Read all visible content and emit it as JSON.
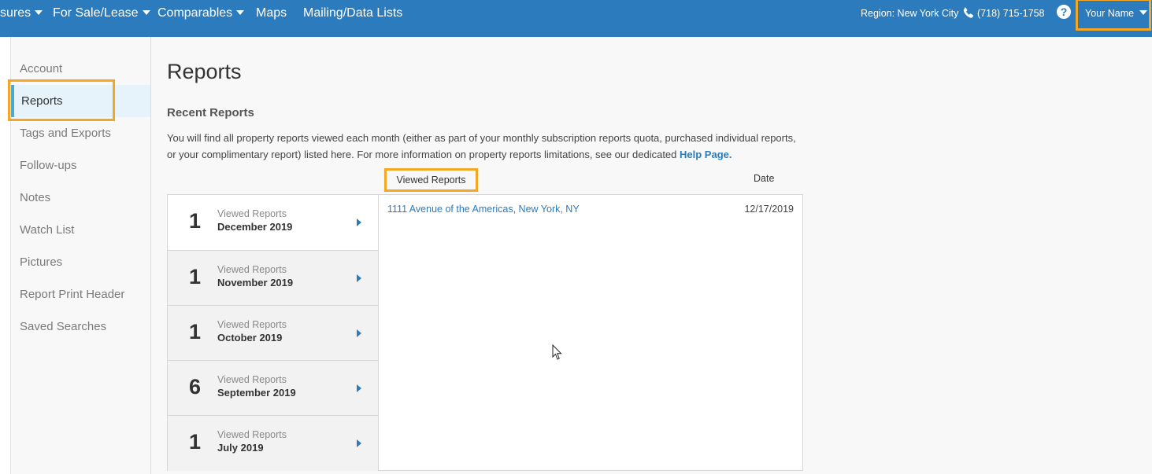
{
  "header": {
    "nav": [
      {
        "label": "sures",
        "caret": true
      },
      {
        "label": "For Sale/Lease",
        "caret": true
      },
      {
        "label": "Comparables",
        "caret": true
      },
      {
        "label": "Maps",
        "caret": false
      },
      {
        "label": "Mailing/Data Lists",
        "caret": false
      }
    ],
    "region": "Region: New York City",
    "phone": "(718) 715-1758",
    "help": "?",
    "user": "Your Name"
  },
  "sidebar": {
    "items": [
      {
        "label": "Account"
      },
      {
        "label": "Reports",
        "active": true
      },
      {
        "label": "Tags and Exports"
      },
      {
        "label": "Follow-ups"
      },
      {
        "label": "Notes"
      },
      {
        "label": "Watch List"
      },
      {
        "label": "Pictures"
      },
      {
        "label": "Report Print Header"
      },
      {
        "label": "Saved Searches"
      }
    ]
  },
  "main": {
    "title": "Reports",
    "section_title": "Recent Reports",
    "description": "You will find all property reports viewed each month (either as part of your monthly subscription reports quota, purchased individual reports, or your complimentary report) listed here. For more information on property reports limitations, see our dedicated ",
    "help_link": "Help Page."
  },
  "table": {
    "col_viewed": "Viewed Reports",
    "col_date": "Date",
    "months": [
      {
        "count": "1",
        "label": "Viewed Reports",
        "month": "December 2019",
        "active": true
      },
      {
        "count": "1",
        "label": "Viewed Reports",
        "month": "November 2019"
      },
      {
        "count": "1",
        "label": "Viewed Reports",
        "month": "October 2019"
      },
      {
        "count": "6",
        "label": "Viewed Reports",
        "month": "September 2019"
      },
      {
        "count": "1",
        "label": "Viewed Reports",
        "month": "July 2019"
      }
    ],
    "reports": [
      {
        "address": "1111 Avenue of the Americas, New York, NY",
        "date": "12/17/2019"
      }
    ]
  },
  "colors": {
    "topbar": "#2b7bbd",
    "highlight": "#f5a623",
    "link": "#2b7bbd",
    "active_sidebar": "#e6f3fb"
  }
}
